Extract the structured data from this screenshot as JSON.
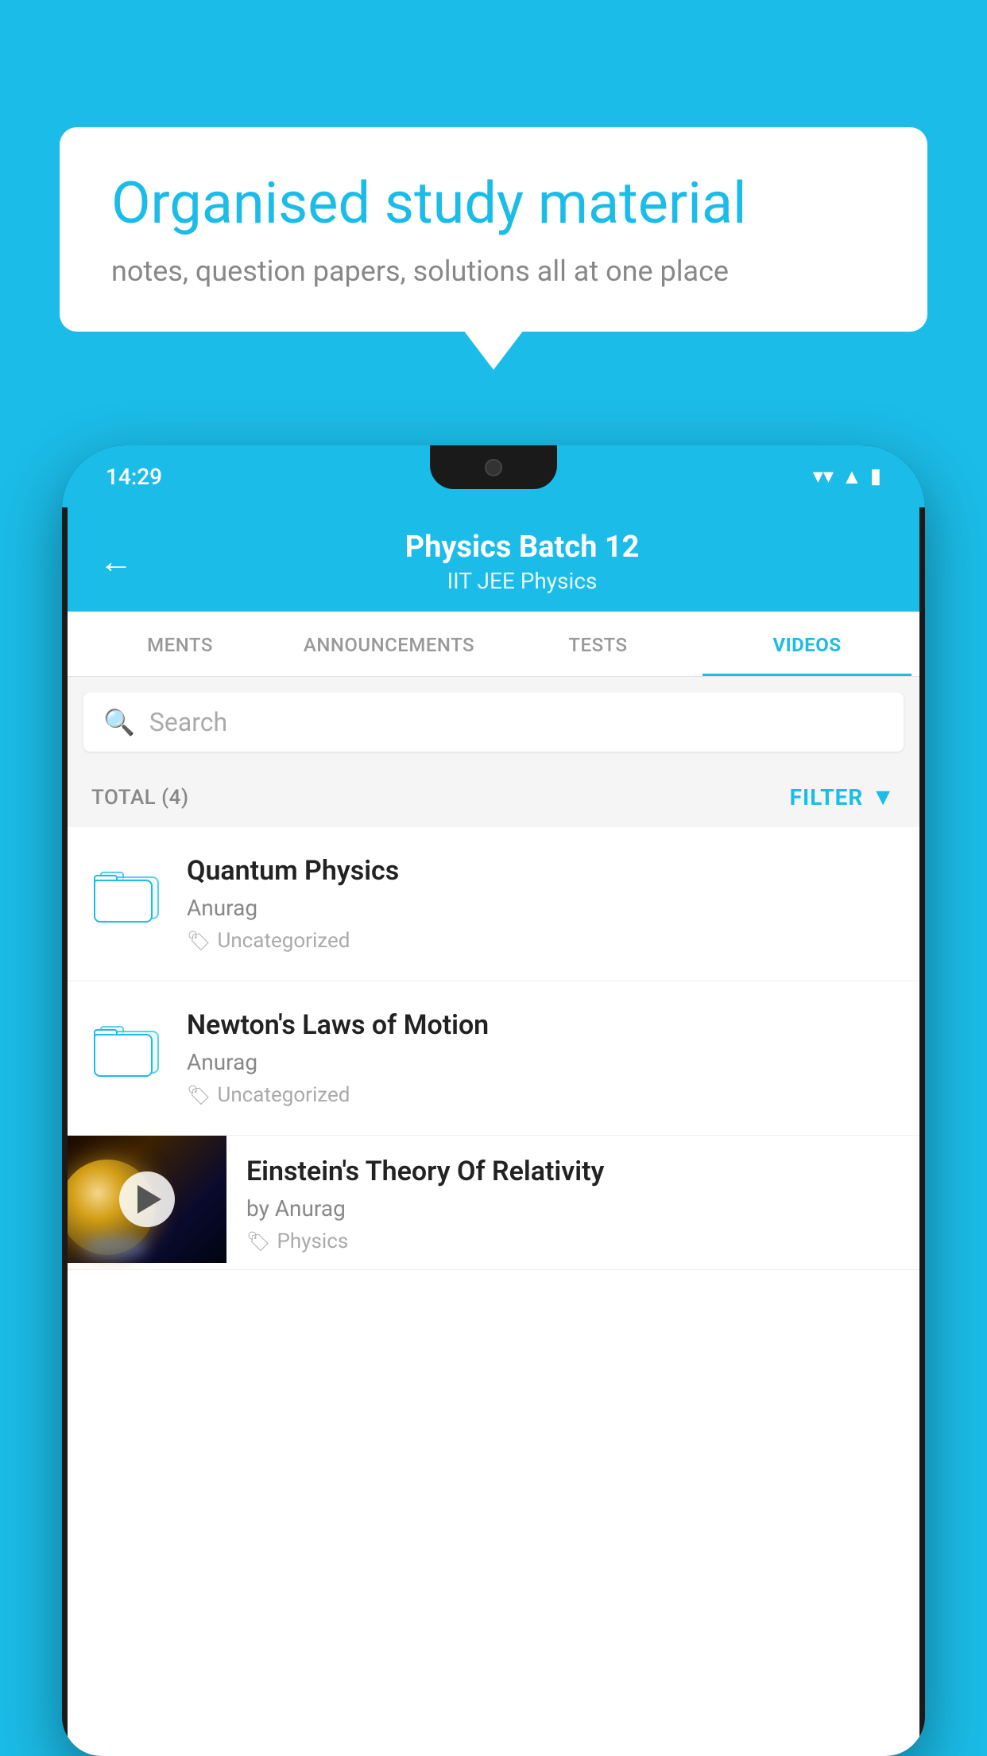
{
  "background_color": "#1BBCE8",
  "speech_bubble": {
    "title": "Organised study material",
    "subtitle": "notes, question papers, solutions all at one place"
  },
  "phone": {
    "status_bar": {
      "time": "14:29",
      "icons": [
        "wifi",
        "signal",
        "battery"
      ]
    },
    "header": {
      "back_label": "←",
      "title": "Physics Batch 12",
      "subtitle": "IIT JEE   Physics"
    },
    "tabs": [
      {
        "label": "MENTS",
        "active": false
      },
      {
        "label": "ANNOUNCEMENTS",
        "active": false
      },
      {
        "label": "TESTS",
        "active": false
      },
      {
        "label": "VIDEOS",
        "active": true
      }
    ],
    "search": {
      "placeholder": "Search"
    },
    "filter_row": {
      "total_label": "TOTAL (4)",
      "filter_label": "FILTER"
    },
    "videos": [
      {
        "title": "Quantum Physics",
        "author": "Anurag",
        "tag": "Uncategorized",
        "has_thumbnail": false
      },
      {
        "title": "Newton's Laws of Motion",
        "author": "Anurag",
        "tag": "Uncategorized",
        "has_thumbnail": false
      },
      {
        "title": "Einstein's Theory Of Relativity",
        "author": "by Anurag",
        "tag": "Physics",
        "has_thumbnail": true
      }
    ]
  }
}
